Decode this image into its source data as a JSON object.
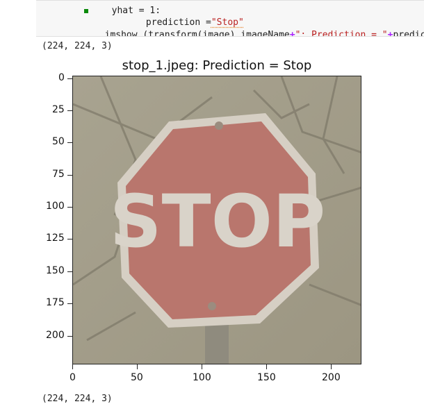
{
  "code": {
    "line0": "    yhat = 1:",
    "line1_prefix": "        prediction =",
    "line1_str": "\"Stop\"",
    "line2_a": "    imshow_(transform(image),imageName",
    "line2_op": "+",
    "line2_str": "\": Prediction = \"",
    "line2_op2": "+",
    "line2_b": "prediction)"
  },
  "outputs": {
    "shape_top": "(224, 224, 3)",
    "shape_bottom": "(224, 224, 3)"
  },
  "figure": {
    "title": "stop_1.jpeg: Prediction = Stop",
    "sign_text": "STOP",
    "x_ticks": [
      "0",
      "50",
      "100",
      "150",
      "200"
    ],
    "y_ticks": [
      "0",
      "25",
      "50",
      "75",
      "100",
      "125",
      "150",
      "175",
      "200"
    ]
  }
}
